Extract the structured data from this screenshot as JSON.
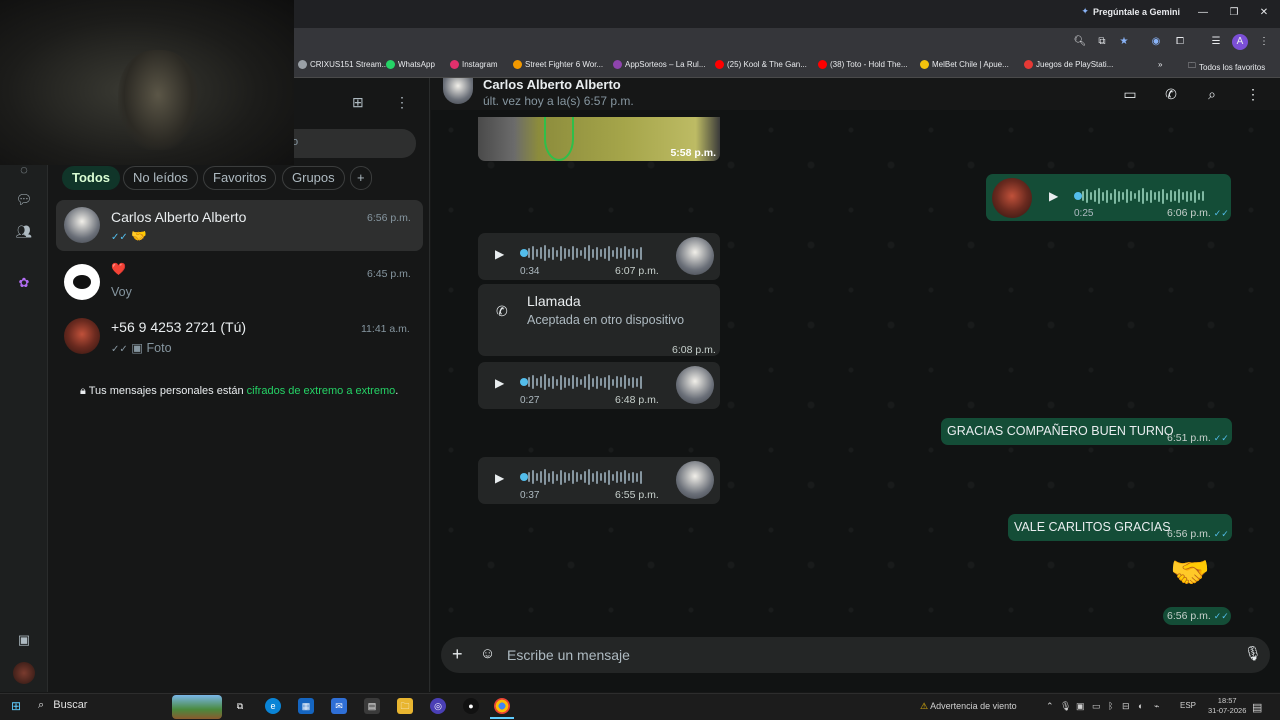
{
  "browser": {
    "gemini_label": "Pregúntale a Gemini",
    "bookmarks": [
      {
        "label": "CRIXUS151 Stream...",
        "color": "#9aa0a6"
      },
      {
        "label": "WhatsApp",
        "color": "#25d366"
      },
      {
        "label": "Instagram",
        "color": "#e1306c"
      },
      {
        "label": "Street Fighter 6 Wor...",
        "color": "#f29900"
      },
      {
        "label": "AppSorteos – La Rul...",
        "color": "#8e44ad"
      },
      {
        "label": "(25) Kool & The Gan...",
        "color": "#ff0000"
      },
      {
        "label": "(38) Toto - Hold The...",
        "color": "#ff0000"
      },
      {
        "label": "MelBet Chile | Apue...",
        "color": "#f4c20d"
      },
      {
        "label": "Juegos de PlayStati...",
        "color": "#e53935"
      }
    ],
    "more_bookmarks": "»",
    "all_favorites": "Todos los favoritos"
  },
  "chatlist": {
    "filters": [
      "Todos",
      "No leídos",
      "Favoritos",
      "Grupos"
    ],
    "add_filter": "+",
    "search_fragment": "o",
    "chats": [
      {
        "name": "Carlos Alberto Alberto",
        "preview": "🤝",
        "time": "6:56 p.m."
      },
      {
        "name": "❤️",
        "preview": "Voy",
        "time": "6:45 p.m."
      },
      {
        "name": "+56 9 4253 2721",
        "name_suffix": "(Tú)",
        "preview": "Foto",
        "time": "11:41 a.m."
      }
    ],
    "encryption_prefix": "Tus mensajes personales están ",
    "encryption_link": "cifrados de extremo a extremo",
    "encryption_suffix": "."
  },
  "conversation": {
    "contact_name": "Carlos Alberto Alberto",
    "last_seen": "últ. vez hoy a la(s) 6:57 p.m.",
    "image_time": "5:58 p.m.",
    "out_voice": {
      "duration": "0:25",
      "time": "6:06 p.m."
    },
    "in_voice_1": {
      "duration": "0:34",
      "time": "6:07 p.m."
    },
    "call": {
      "title": "Llamada",
      "subtitle": "Aceptada en otro dispositivo",
      "time": "6:08 p.m."
    },
    "in_voice_2": {
      "duration": "0:27",
      "time": "6:48 p.m."
    },
    "out_text_1": {
      "text": "GRACIAS COMPAÑERO BUEN TURNO",
      "time": "6:51 p.m."
    },
    "in_voice_3": {
      "duration": "0:37",
      "time": "6:55 p.m."
    },
    "out_text_2": {
      "text": "VALE CARLITOS GRACIAS",
      "time": "6:56 p.m."
    },
    "out_emoji": {
      "emoji": "🤝",
      "time": "6:56 p.m."
    },
    "composer_placeholder": "Escribe un mensaje"
  },
  "taskbar": {
    "search_label": "Buscar",
    "weather": "Advertencia de viento",
    "language": "ESP",
    "clock_time": "18:57",
    "clock_date": "31-07-2026"
  },
  "colors": {
    "accent": "#25d366",
    "out_bubble": "#144d37"
  }
}
